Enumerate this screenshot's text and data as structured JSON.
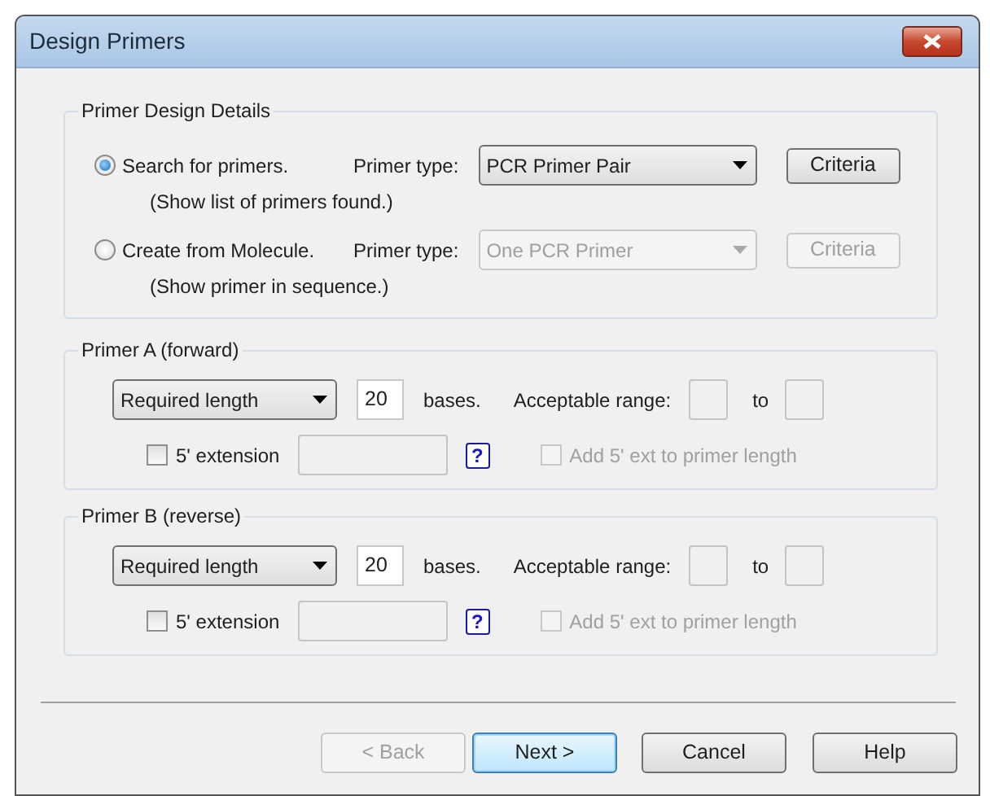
{
  "window": {
    "title": "Design Primers"
  },
  "details": {
    "title": "Primer Design Details",
    "options": [
      {
        "label": "Search for primers.",
        "note": "(Show list of primers found.)",
        "selected": true,
        "type_label": "Primer type:",
        "type_value": "PCR Primer Pair",
        "disabled": false,
        "criteria": "Criteria"
      },
      {
        "label": "Create from Molecule.",
        "note": "(Show primer in sequence.)",
        "selected": false,
        "type_label": "Primer type:",
        "type_value": "One PCR Primer",
        "disabled": true,
        "criteria": "Criteria"
      }
    ]
  },
  "primers": [
    {
      "title": "Primer A (forward)",
      "length_mode": "Required length",
      "bases": "20",
      "bases_label": "bases.",
      "range_label": "Acceptable range:",
      "to_label": "to",
      "extension": {
        "label": "5' extension",
        "checked": false
      },
      "help": "?",
      "add_ext": {
        "label": "Add 5' ext to primer length",
        "checked": false,
        "disabled": true
      }
    },
    {
      "title": "Primer B (reverse)",
      "length_mode": "Required length",
      "bases": "20",
      "bases_label": "bases.",
      "range_label": "Acceptable range:",
      "to_label": "to",
      "extension": {
        "label": "5' extension",
        "checked": false
      },
      "help": "?",
      "add_ext": {
        "label": "Add 5' ext to primer length",
        "checked": false,
        "disabled": true
      }
    }
  ],
  "buttons": [
    {
      "label": "< Back",
      "disabled": true,
      "default": false
    },
    {
      "label": "Next >",
      "disabled": false,
      "default": true
    },
    {
      "label": "Cancel",
      "disabled": false,
      "default": false
    },
    {
      "label": "Help",
      "disabled": false,
      "default": false
    }
  ]
}
